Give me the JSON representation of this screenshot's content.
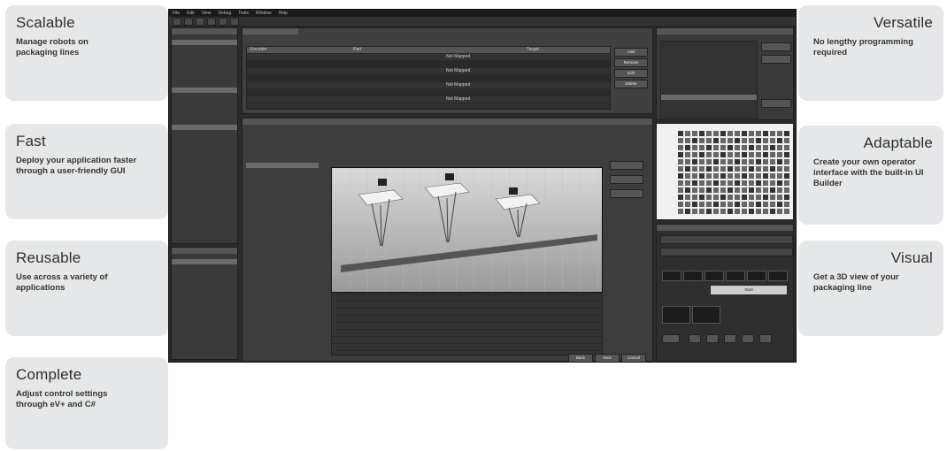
{
  "features": {
    "scalable": {
      "title": "Scalable",
      "desc": "Manage robots on packaging lines"
    },
    "fast": {
      "title": "Fast",
      "desc": "Deploy your application faster through a user-friendly GUI"
    },
    "reusable": {
      "title": "Reusable",
      "desc": "Use across a variety of applications"
    },
    "complete": {
      "title": "Complete",
      "desc": "Adjust control settings through eV+ and C#"
    },
    "versatile": {
      "title": "Versatile",
      "desc": "No lengthy programming required"
    },
    "adaptable": {
      "title": "Adaptable",
      "desc": "Create your own operator interface with the built-in UI Builder"
    },
    "visual": {
      "title": "Visual",
      "desc": "Get a 3D view of your packaging line"
    }
  },
  "app": {
    "menu": [
      "File",
      "Edit",
      "View",
      "Debug",
      "Tools",
      "Window",
      "Help"
    ],
    "table_headers": [
      "Encoder",
      "Part",
      "Target"
    ],
    "table_cell": "Not Mapped",
    "dialog_buttons": [
      "Back",
      "Next",
      "Cancel"
    ],
    "side_buttons": [
      "Add",
      "Remove",
      "Edit",
      "Delete"
    ],
    "start_button": "Start"
  },
  "colors": {
    "card_bg": "#e6e7e8",
    "app_bg": "#2b2b2b"
  }
}
